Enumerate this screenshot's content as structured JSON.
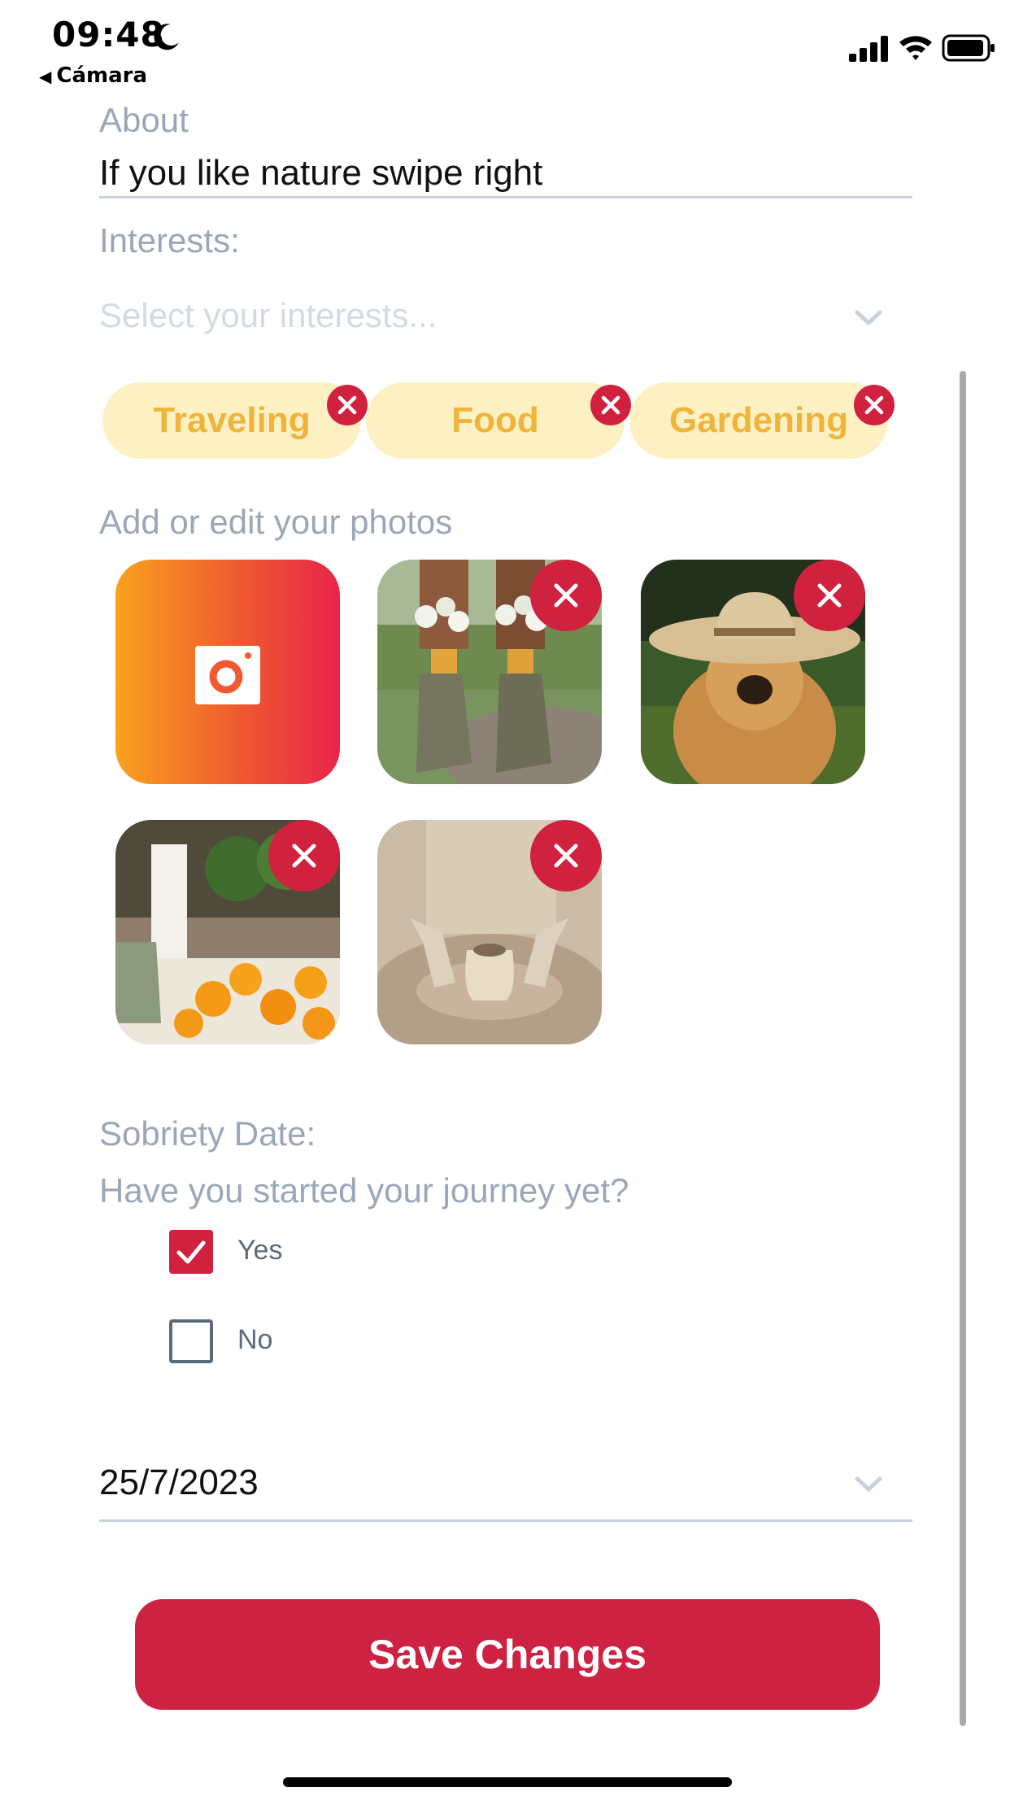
{
  "status_bar": {
    "time": "09:48",
    "back_app": "Cámara"
  },
  "about": {
    "label": "About",
    "value": "If you like nature swipe right"
  },
  "interests": {
    "label": "Interests:",
    "placeholder": "Select your interests...",
    "chips": [
      "Traveling",
      "Food",
      "Gardening"
    ]
  },
  "photos": {
    "label": "Add or edit your photos",
    "items": [
      "flower-boots-photo",
      "dog-in-hat-photo",
      "oranges-kitchen-photo",
      "pottery-wheel-photo"
    ]
  },
  "sobriety": {
    "label": "Sobriety Date:",
    "question": "Have you started your journey yet?",
    "options": [
      {
        "label": "Yes",
        "checked": true
      },
      {
        "label": "No",
        "checked": false
      }
    ],
    "date": "25/7/2023"
  },
  "save_button": "Save Changes",
  "colors": {
    "accent": "#cd2242",
    "chip_bg": "#fdf1c4",
    "chip_text": "#f0b43a",
    "label": "#9aa7b8"
  }
}
